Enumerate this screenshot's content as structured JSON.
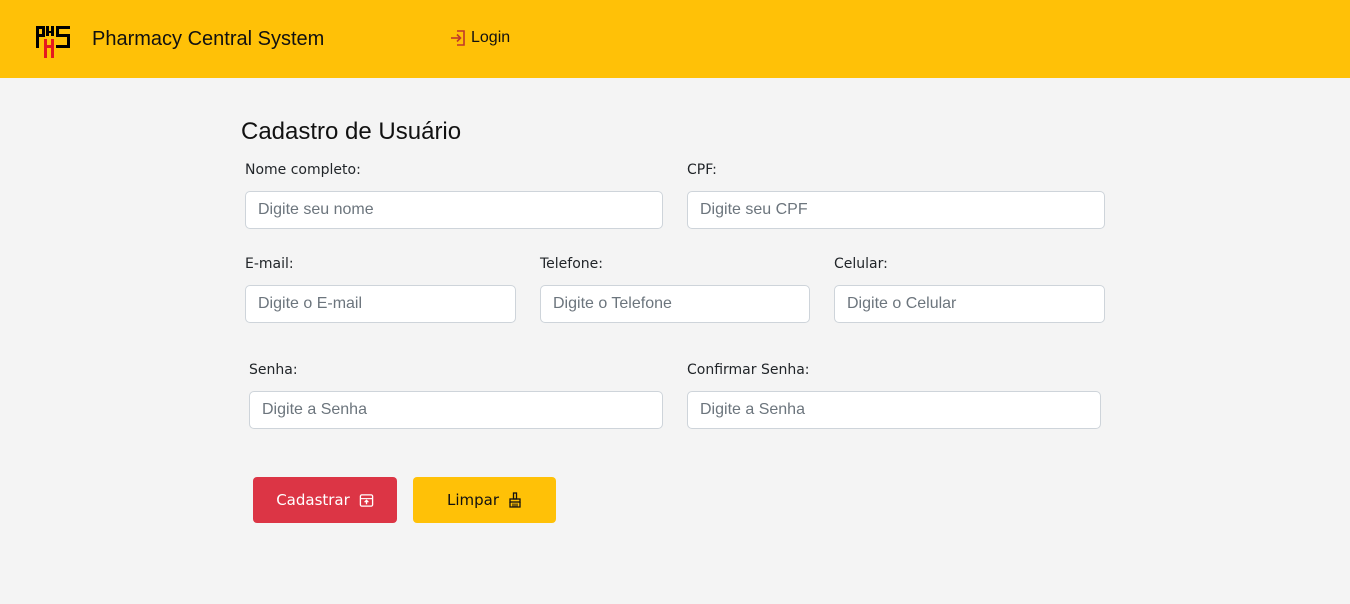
{
  "header": {
    "logo_text": "PHS",
    "brand": "Pharmacy Central System",
    "login_label": "Login",
    "accent_color": "#ffc107"
  },
  "form": {
    "title": "Cadastro de Usuário",
    "fields": {
      "nome": {
        "label": "Nome completo:",
        "placeholder": "Digite seu nome",
        "value": ""
      },
      "cpf": {
        "label": "CPF:",
        "placeholder": "Digite seu CPF",
        "value": ""
      },
      "email": {
        "label": "E-mail:",
        "placeholder": "Digite o E-mail",
        "value": ""
      },
      "telefone": {
        "label": "Telefone:",
        "placeholder": "Digite o Telefone",
        "value": ""
      },
      "celular": {
        "label": "Celular:",
        "placeholder": "Digite o Celular",
        "value": ""
      },
      "senha": {
        "label": "Senha:",
        "placeholder": "Digite a Senha",
        "value": ""
      },
      "confirmar_senha": {
        "label": "Confirmar Senha:",
        "placeholder": "Digite a Senha",
        "value": ""
      }
    },
    "buttons": {
      "submit_label": "Cadastrar",
      "submit_icon": "archive-upload-icon",
      "submit_color": "#dc3545",
      "clear_label": "Limpar",
      "clear_icon": "broom-icon",
      "clear_color": "#ffc107"
    }
  }
}
